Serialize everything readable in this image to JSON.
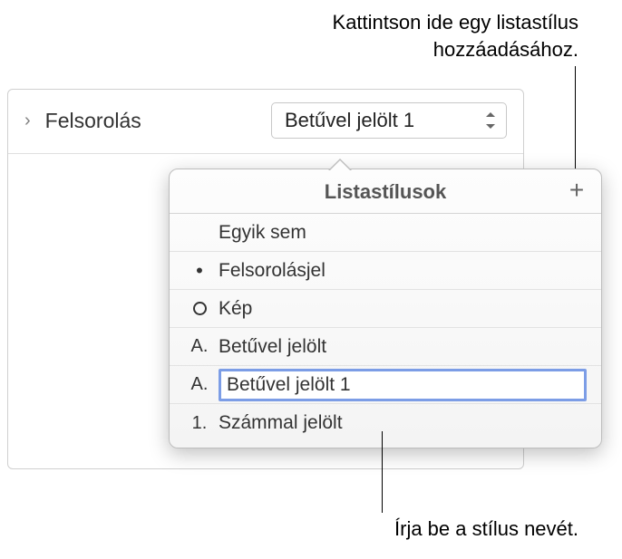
{
  "annotations": {
    "top": "Kattintson ide egy listastílus hozzáadásához.",
    "bottom": "Írja be a stílus nevét."
  },
  "header": {
    "label": "Felsorolás",
    "dropdown_value": "Betűvel jelölt 1"
  },
  "popover": {
    "title": "Listastílusok",
    "add_symbol": "+",
    "items": [
      {
        "bullet": "",
        "bullet_type": "none",
        "label": "Egyik sem"
      },
      {
        "bullet": "•",
        "bullet_type": "dot",
        "label": "Felsorolásjel"
      },
      {
        "bullet": "",
        "bullet_type": "circle",
        "label": "Kép"
      },
      {
        "bullet": "A.",
        "bullet_type": "text",
        "label": "Betűvel jelölt"
      },
      {
        "bullet": "A.",
        "bullet_type": "text",
        "label": "Betűvel jelölt 1",
        "editing": true
      },
      {
        "bullet": "1.",
        "bullet_type": "text",
        "label": "Számmal jelölt"
      }
    ]
  }
}
